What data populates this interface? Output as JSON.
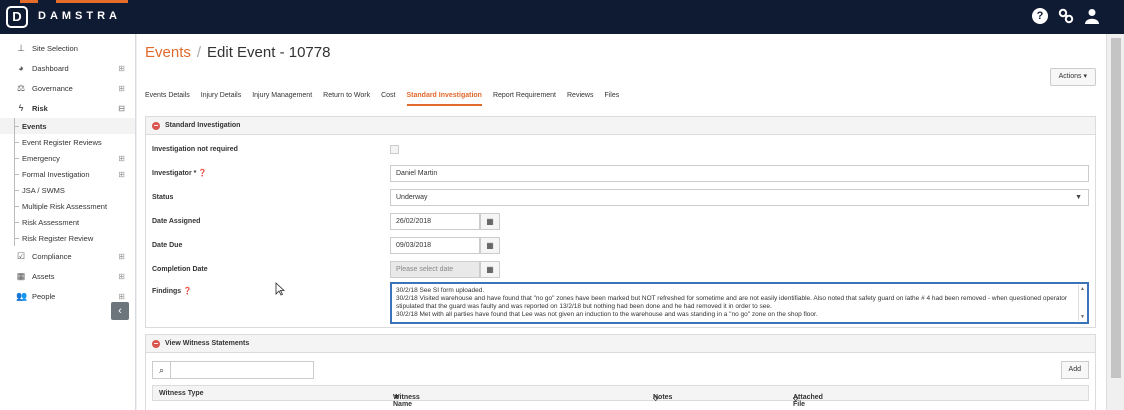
{
  "app": {
    "brand": "DAMSTRA",
    "logo_letter": "D"
  },
  "top_icons": [
    "help-icon",
    "settings-icon",
    "user-icon"
  ],
  "sidebar": {
    "items": [
      {
        "label": "Site Selection",
        "icon": "sitemap-icon"
      },
      {
        "label": "Dashboard",
        "icon": "dashboard-icon",
        "expander": "⊞"
      },
      {
        "label": "Governance",
        "icon": "balance-icon",
        "expander": "⊞"
      },
      {
        "label": "Risk",
        "icon": "risk-icon",
        "expander": "⊟"
      },
      {
        "label": "Events"
      },
      {
        "label": "Event Register Reviews"
      },
      {
        "label": "Emergency",
        "expander": "⊞"
      },
      {
        "label": "Formal Investigation",
        "expander": "⊞"
      },
      {
        "label": "JSA / SWMS"
      },
      {
        "label": "Multiple Risk Assessment"
      },
      {
        "label": "Risk Assessment"
      },
      {
        "label": "Risk Register Review"
      },
      {
        "label": "Compliance",
        "icon": "check-icon",
        "expander": "⊞"
      },
      {
        "label": "Assets",
        "icon": "assets-icon",
        "expander": "⊞"
      },
      {
        "label": "People",
        "icon": "people-icon",
        "expander": "⊞"
      }
    ]
  },
  "header": {
    "crumb": "Events",
    "separator": "/",
    "title": "Edit Event - 10778",
    "actions_label": "Actions ▾"
  },
  "tabs": [
    "Events Details",
    "Injury Details",
    "Injury Management",
    "Return to Work",
    "Cost",
    "Standard Investigation",
    "Report Requirement",
    "Reviews",
    "Files"
  ],
  "active_tab": "Standard Investigation",
  "investigation": {
    "heading": "Standard Investigation",
    "not_required_label": "Investigation not required",
    "investigator_label": "Investigator * ❓",
    "investigator_value": "Daniel Martin",
    "status_label": "Status",
    "status_value": "Underway",
    "date_assigned_label": "Date Assigned",
    "date_assigned_value": "26/02/2018",
    "date_due_label": "Date Due",
    "date_due_value": "09/03/2018",
    "completion_label": "Completion Date",
    "completion_placeholder": "Please select date",
    "findings_label": "Findings ❓",
    "findings_lines": [
      "30/2/18 See SI form uploaded.",
      "30/2/18 Visited warehouse and have found that \"no go\" zones have been marked but NOT refreshed for sometime and are not easily identifiable. Also noted that safety guard on lathe # 4 had been removed - when questioned operator stipulated that the guard was faulty and was reported on 13/2/18 but nothing had been done and he had removed it in order to see.",
      "30/2/18 Met with all parties have found that Lee was not given an induction to the warehouse and was standing in a \"no go\" zone on the shop floor."
    ]
  },
  "witness": {
    "heading": "View Witness Statements",
    "add_label": "Add",
    "columns": [
      "Witness Type",
      "Witness Name",
      "Notes",
      "Attached File"
    ]
  }
}
